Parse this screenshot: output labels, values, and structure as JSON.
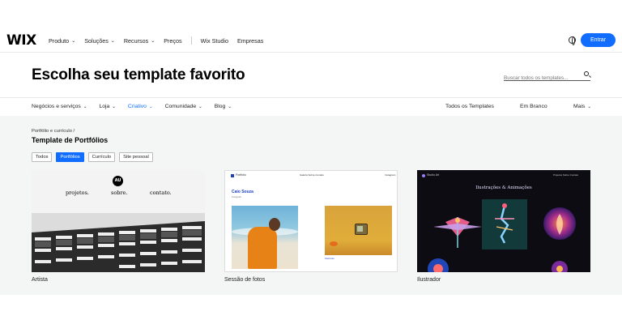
{
  "nav": {
    "logo": "WIX",
    "items": [
      {
        "label": "Produto",
        "dropdown": true
      },
      {
        "label": "Soluções",
        "dropdown": true
      },
      {
        "label": "Recursos",
        "dropdown": true
      },
      {
        "label": "Preços",
        "dropdown": false
      }
    ],
    "secondary": [
      "Wix Studio",
      "Empresas"
    ],
    "login_label": "Entrar",
    "accent_color": "#116dff"
  },
  "header": {
    "title": "Escolha seu template favorito",
    "search_placeholder": "Buscar todos os templates..."
  },
  "categories": {
    "items": [
      {
        "label": "Negócios e serviços",
        "active": false
      },
      {
        "label": "Loja",
        "active": false
      },
      {
        "label": "Criativo",
        "active": true
      },
      {
        "label": "Comunidade",
        "active": false
      },
      {
        "label": "Blog",
        "active": false
      }
    ],
    "right": [
      "Todos os Templates",
      "Em Branco",
      "Mais"
    ]
  },
  "section": {
    "breadcrumb": "Portfólio e currículo /",
    "title": "Template de Portfólios",
    "filters": [
      {
        "label": "Todos",
        "active": false
      },
      {
        "label": "Portfólios",
        "active": true
      },
      {
        "label": "Currículo",
        "active": false
      },
      {
        "label": "Site pessoal",
        "active": false
      }
    ]
  },
  "templates": [
    {
      "name": "Artista",
      "preview": {
        "logo": "AU",
        "links": [
          "projetos.",
          "sobre.",
          "contato."
        ]
      }
    },
    {
      "name": "Sessão de fotos",
      "preview": {
        "brand": "Portfolio",
        "nav": "Galeria    Sobre    Contato",
        "right": "Instagram",
        "person": "Caio Souza",
        "subtitle": "Fotógrafo",
        "caption": "Interiores"
      }
    },
    {
      "name": "Ilustrador",
      "preview": {
        "brand": "Studio Art",
        "nav": "Projetos     Sobre     Contato",
        "title": "Ilustrações & Animações"
      }
    }
  ]
}
